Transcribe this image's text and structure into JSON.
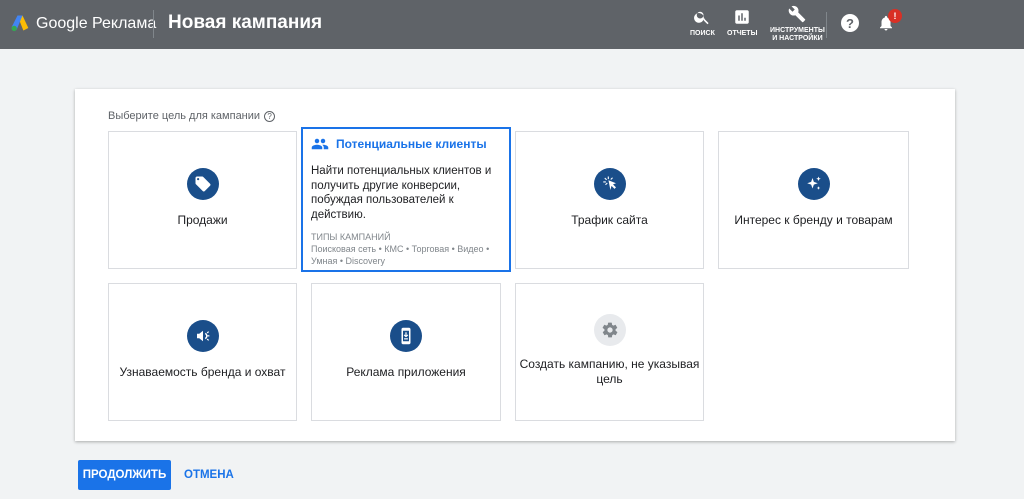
{
  "header": {
    "brand": "Google Реклама",
    "title": "Новая кампания",
    "tools": {
      "search_label": "ПОИСК",
      "reports_label": "ОТЧЕТЫ",
      "tools_label_line1": "ИНСТРУМЕНТЫ",
      "tools_label_line2": "И НАСТРОЙКИ"
    },
    "help_glyph": "?",
    "notification_badge": "!"
  },
  "goal": {
    "prompt": "Выберите цель для кампании",
    "prompt_help_glyph": "?",
    "cards": [
      {
        "id": "sales",
        "label": "Продажи",
        "icon": "tag-icon"
      },
      {
        "id": "leads",
        "label": "Потенциальные клиенты",
        "icon": "people-icon",
        "selected": true,
        "description": "Найти потенциальных клиентов и получить другие конверсии, побуждая пользователей к действию.",
        "types_heading": "ТИПЫ КАМПАНИЙ",
        "types": "Поисковая сеть • КМС • Торговая • Видео • Умная • Discovery"
      },
      {
        "id": "traffic",
        "label": "Трафик сайта",
        "icon": "cursor-click-icon"
      },
      {
        "id": "consideration",
        "label": "Интерес к бренду и товарам",
        "icon": "sparkle-icon"
      },
      {
        "id": "awareness",
        "label": "Узнаваемость бренда и охват",
        "icon": "megaphone-icon"
      },
      {
        "id": "app",
        "label": "Реклама приложения",
        "icon": "phone-icon"
      },
      {
        "id": "no-goal",
        "label": "Создать кампанию, не указывая цель",
        "icon": "gear-icon"
      }
    ]
  },
  "actions": {
    "continue_label": "ПРОДОЛЖИТЬ",
    "cancel_label": "ОТМЕНА"
  },
  "colors": {
    "header_bg": "#5f6368",
    "accent": "#1a73e8",
    "icon_circle": "#1a4e8a",
    "badge": "#d93025"
  }
}
